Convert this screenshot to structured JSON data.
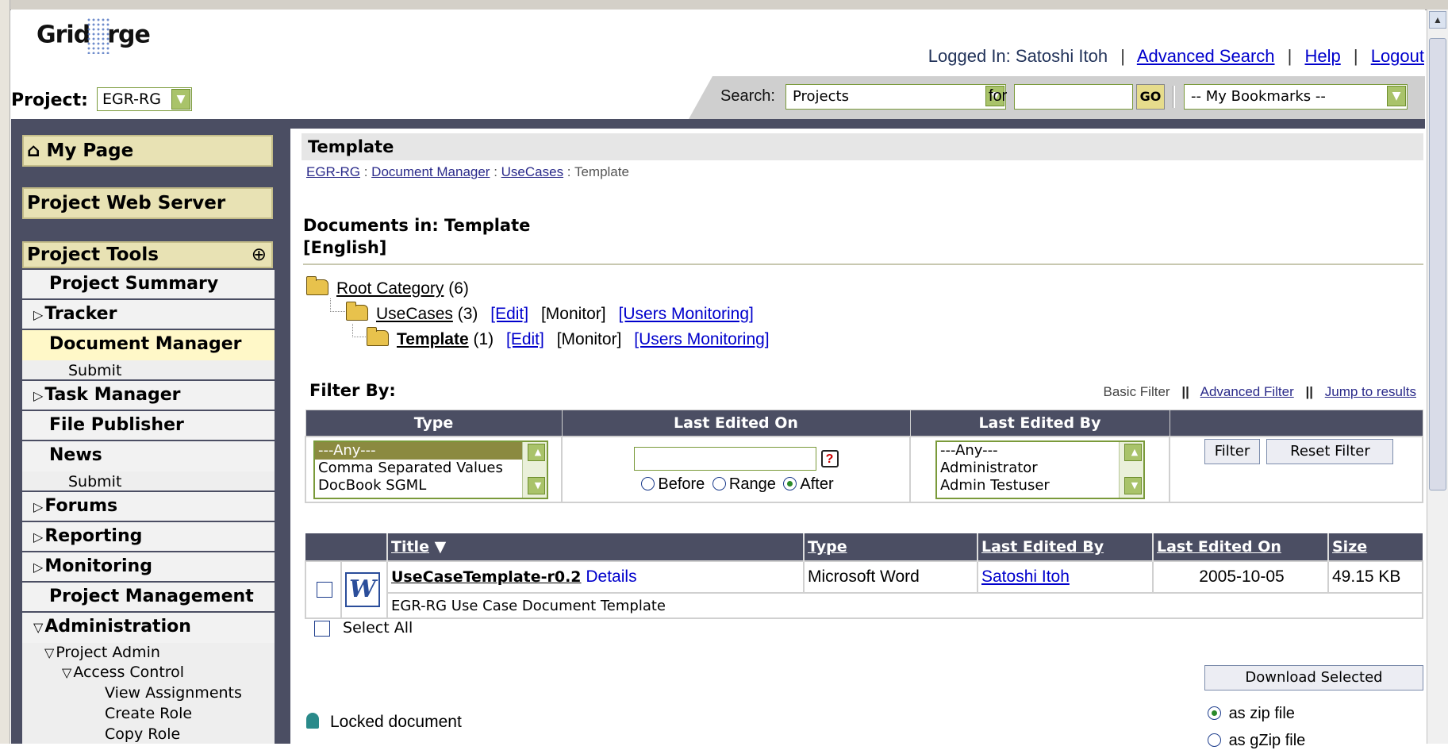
{
  "header": {
    "logo_text_left": "Grid",
    "logo_text_right": "rge",
    "logged_in": "Logged In: Satoshi Itoh",
    "links": [
      "Advanced Search",
      "Help",
      "Logout"
    ],
    "project_label": "Project:",
    "project_value": "EGR-RG",
    "search_label": "Search:",
    "search_scope": "Projects",
    "for_label": "for",
    "search_value": "",
    "go_label": "GO",
    "bookmarks": "-- My Bookmarks --"
  },
  "sidebar": {
    "my_page": "My Page",
    "project_web_server": "Project Web Server",
    "project_tools": "Project Tools",
    "items": [
      {
        "label": "Project Summary",
        "expander": ""
      },
      {
        "label": "Tracker",
        "expander": "▷"
      },
      {
        "label": "Document Manager",
        "expander": ""
      },
      {
        "label": "Submit"
      },
      {
        "label": "Task Manager",
        "expander": "▷"
      },
      {
        "label": "File Publisher",
        "expander": ""
      },
      {
        "label": "News",
        "expander": ""
      },
      {
        "label": "Submit"
      },
      {
        "label": "Forums",
        "expander": "▷"
      },
      {
        "label": "Reporting",
        "expander": "▷"
      },
      {
        "label": "Monitoring",
        "expander": "▷"
      },
      {
        "label": "Project Management",
        "expander": ""
      },
      {
        "label": "Administration",
        "expander": "▽"
      }
    ],
    "admin_sub": [
      "Project Admin",
      "Access Control",
      "View Assignments",
      "Create Role",
      "Copy Role"
    ]
  },
  "main": {
    "title": "Template",
    "breadcrumb": [
      "EGR-RG",
      "Document Manager",
      "UseCases",
      "Template"
    ],
    "docs_in": "Documents in: Template",
    "language": "[English]",
    "tree": [
      {
        "name": "Root Category",
        "count": "(6)"
      },
      {
        "name": "UseCases",
        "count": "(3)",
        "edit": "[Edit]",
        "monitor": "[Monitor]",
        "users": "[Users Monitoring]"
      },
      {
        "name": "Template",
        "count": "(1)",
        "edit": "[Edit]",
        "monitor": "[Monitor]",
        "users": "[Users Monitoring]"
      }
    ],
    "filter": {
      "title": "Filter By:",
      "basic": "Basic Filter",
      "advanced": "Advanced Filter",
      "jump": "Jump to results",
      "headers": [
        "Type",
        "Last Edited On",
        "Last Edited By",
        ""
      ],
      "type_options": [
        "---Any---",
        "Comma Separated Values",
        "DocBook SGML"
      ],
      "date_value": "",
      "date_modes": [
        "Before",
        "Range",
        "After"
      ],
      "date_mode_selected": "After",
      "user_options": [
        "---Any---",
        "Administrator",
        "Admin Testuser"
      ],
      "filter_btn": "Filter",
      "reset_btn": "Reset Filter"
    },
    "table": {
      "headers": [
        "Title",
        "Type",
        "Last Edited By",
        "Last Edited On",
        "Size"
      ],
      "rows": [
        {
          "title": "UseCaseTemplate-r0.2",
          "details": "Details",
          "type": "Microsoft Word",
          "editor": "Satoshi Itoh",
          "date": "2005-10-05",
          "size": "49.15 KB",
          "description": "EGR-RG Use Case Document Template",
          "icon_letter": "W"
        }
      ],
      "select_all": "Select All"
    },
    "download": {
      "button": "Download Selected",
      "options": [
        "as zip file",
        "as gZip file"
      ],
      "selected": "as zip file"
    },
    "locked": "Locked document"
  }
}
